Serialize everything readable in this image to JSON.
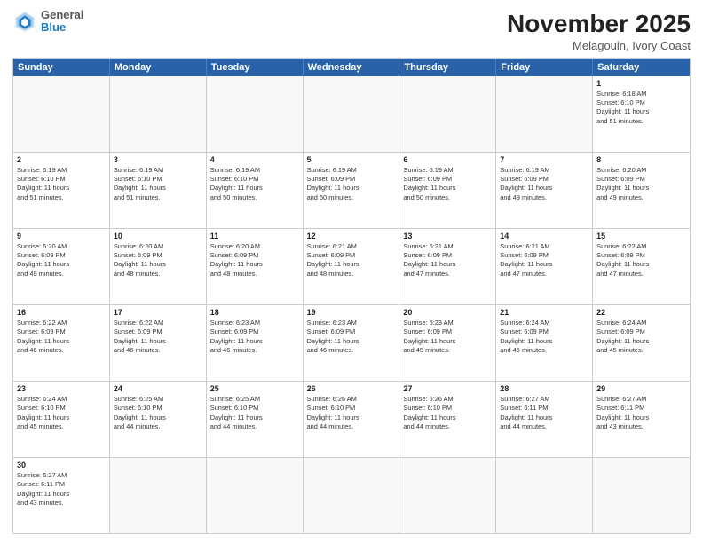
{
  "header": {
    "logo_general": "General",
    "logo_blue": "Blue",
    "title": "November 2025",
    "subtitle": "Melagouin, Ivory Coast"
  },
  "weekdays": [
    "Sunday",
    "Monday",
    "Tuesday",
    "Wednesday",
    "Thursday",
    "Friday",
    "Saturday"
  ],
  "rows": [
    [
      {
        "day": "",
        "text": ""
      },
      {
        "day": "",
        "text": ""
      },
      {
        "day": "",
        "text": ""
      },
      {
        "day": "",
        "text": ""
      },
      {
        "day": "",
        "text": ""
      },
      {
        "day": "",
        "text": ""
      },
      {
        "day": "1",
        "text": "Sunrise: 6:18 AM\nSunset: 6:10 PM\nDaylight: 11 hours\nand 51 minutes."
      }
    ],
    [
      {
        "day": "2",
        "text": "Sunrise: 6:19 AM\nSunset: 6:10 PM\nDaylight: 11 hours\nand 51 minutes."
      },
      {
        "day": "3",
        "text": "Sunrise: 6:19 AM\nSunset: 6:10 PM\nDaylight: 11 hours\nand 51 minutes."
      },
      {
        "day": "4",
        "text": "Sunrise: 6:19 AM\nSunset: 6:10 PM\nDaylight: 11 hours\nand 50 minutes."
      },
      {
        "day": "5",
        "text": "Sunrise: 6:19 AM\nSunset: 6:09 PM\nDaylight: 11 hours\nand 50 minutes."
      },
      {
        "day": "6",
        "text": "Sunrise: 6:19 AM\nSunset: 6:09 PM\nDaylight: 11 hours\nand 50 minutes."
      },
      {
        "day": "7",
        "text": "Sunrise: 6:19 AM\nSunset: 6:09 PM\nDaylight: 11 hours\nand 49 minutes."
      },
      {
        "day": "8",
        "text": "Sunrise: 6:20 AM\nSunset: 6:09 PM\nDaylight: 11 hours\nand 49 minutes."
      }
    ],
    [
      {
        "day": "9",
        "text": "Sunrise: 6:20 AM\nSunset: 6:09 PM\nDaylight: 11 hours\nand 49 minutes."
      },
      {
        "day": "10",
        "text": "Sunrise: 6:20 AM\nSunset: 6:09 PM\nDaylight: 11 hours\nand 48 minutes."
      },
      {
        "day": "11",
        "text": "Sunrise: 6:20 AM\nSunset: 6:09 PM\nDaylight: 11 hours\nand 48 minutes."
      },
      {
        "day": "12",
        "text": "Sunrise: 6:21 AM\nSunset: 6:09 PM\nDaylight: 11 hours\nand 48 minutes."
      },
      {
        "day": "13",
        "text": "Sunrise: 6:21 AM\nSunset: 6:09 PM\nDaylight: 11 hours\nand 47 minutes."
      },
      {
        "day": "14",
        "text": "Sunrise: 6:21 AM\nSunset: 6:09 PM\nDaylight: 11 hours\nand 47 minutes."
      },
      {
        "day": "15",
        "text": "Sunrise: 6:22 AM\nSunset: 6:09 PM\nDaylight: 11 hours\nand 47 minutes."
      }
    ],
    [
      {
        "day": "16",
        "text": "Sunrise: 6:22 AM\nSunset: 6:09 PM\nDaylight: 11 hours\nand 46 minutes."
      },
      {
        "day": "17",
        "text": "Sunrise: 6:22 AM\nSunset: 6:09 PM\nDaylight: 11 hours\nand 46 minutes."
      },
      {
        "day": "18",
        "text": "Sunrise: 6:23 AM\nSunset: 6:09 PM\nDaylight: 11 hours\nand 46 minutes."
      },
      {
        "day": "19",
        "text": "Sunrise: 6:23 AM\nSunset: 6:09 PM\nDaylight: 11 hours\nand 46 minutes."
      },
      {
        "day": "20",
        "text": "Sunrise: 6:23 AM\nSunset: 6:09 PM\nDaylight: 11 hours\nand 45 minutes."
      },
      {
        "day": "21",
        "text": "Sunrise: 6:24 AM\nSunset: 6:09 PM\nDaylight: 11 hours\nand 45 minutes."
      },
      {
        "day": "22",
        "text": "Sunrise: 6:24 AM\nSunset: 6:09 PM\nDaylight: 11 hours\nand 45 minutes."
      }
    ],
    [
      {
        "day": "23",
        "text": "Sunrise: 6:24 AM\nSunset: 6:10 PM\nDaylight: 11 hours\nand 45 minutes."
      },
      {
        "day": "24",
        "text": "Sunrise: 6:25 AM\nSunset: 6:10 PM\nDaylight: 11 hours\nand 44 minutes."
      },
      {
        "day": "25",
        "text": "Sunrise: 6:25 AM\nSunset: 6:10 PM\nDaylight: 11 hours\nand 44 minutes."
      },
      {
        "day": "26",
        "text": "Sunrise: 6:26 AM\nSunset: 6:10 PM\nDaylight: 11 hours\nand 44 minutes."
      },
      {
        "day": "27",
        "text": "Sunrise: 6:26 AM\nSunset: 6:10 PM\nDaylight: 11 hours\nand 44 minutes."
      },
      {
        "day": "28",
        "text": "Sunrise: 6:27 AM\nSunset: 6:11 PM\nDaylight: 11 hours\nand 44 minutes."
      },
      {
        "day": "29",
        "text": "Sunrise: 6:27 AM\nSunset: 6:11 PM\nDaylight: 11 hours\nand 43 minutes."
      }
    ],
    [
      {
        "day": "30",
        "text": "Sunrise: 6:27 AM\nSunset: 6:11 PM\nDaylight: 11 hours\nand 43 minutes."
      },
      {
        "day": "",
        "text": ""
      },
      {
        "day": "",
        "text": ""
      },
      {
        "day": "",
        "text": ""
      },
      {
        "day": "",
        "text": ""
      },
      {
        "day": "",
        "text": ""
      },
      {
        "day": "",
        "text": ""
      }
    ]
  ]
}
